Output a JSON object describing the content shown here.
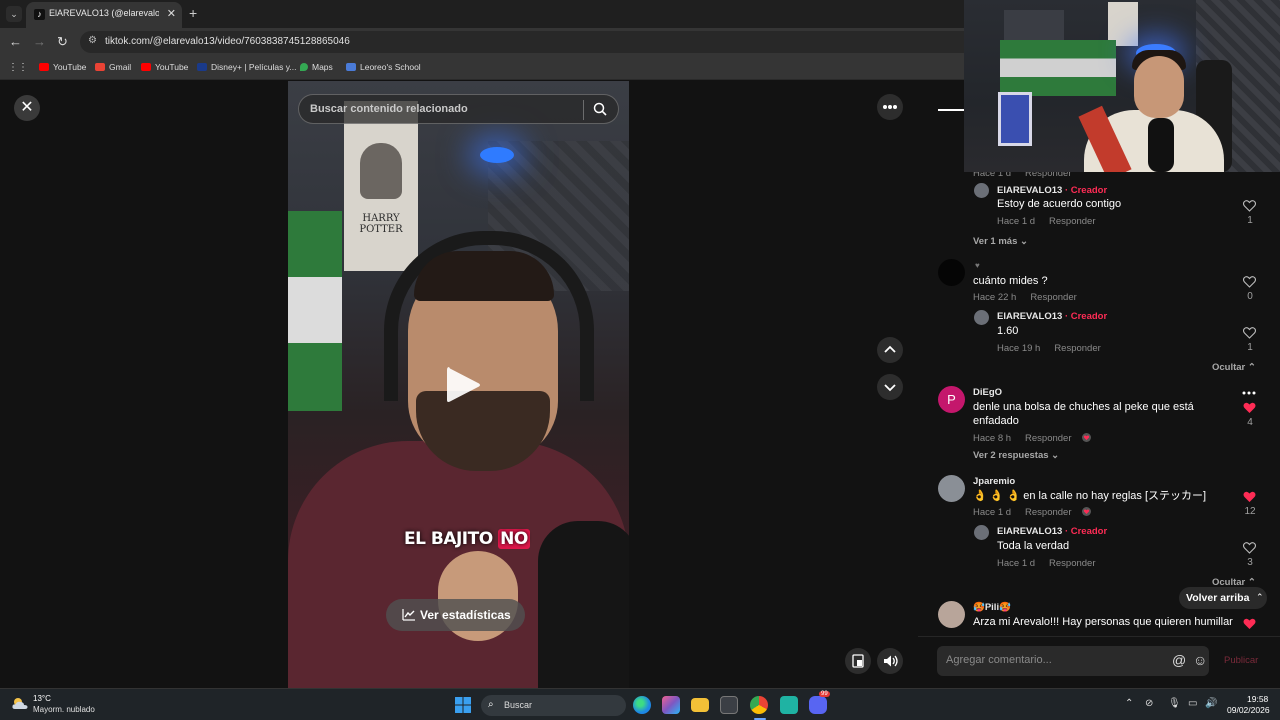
{
  "browser": {
    "tab_title": "ElAREVALO13 (@elarevalo13) |",
    "tab_close": "✕",
    "new_tab": "+",
    "tab_dropdown": "⌄",
    "back": "←",
    "forward": "→",
    "reload": "↻",
    "url": "tiktok.com/@elarevalo13/video/7603838745128865046",
    "bookmarks": [
      {
        "label": "YouTube",
        "icon": "youtube-icon",
        "color": "#ff0000"
      },
      {
        "label": "Gmail",
        "icon": "gmail-icon",
        "color": "#ea4335"
      },
      {
        "label": "YouTube",
        "icon": "youtube-icon",
        "color": "#ff0000"
      },
      {
        "label": "Disney+ | Películas y...",
        "icon": "disney-icon",
        "color": "#1a3a8a"
      },
      {
        "label": "Maps",
        "icon": "maps-icon",
        "color": "#34a853"
      },
      {
        "label": "Leoreo's School",
        "icon": "school-icon",
        "color": "#4a7bd8"
      }
    ]
  },
  "video": {
    "search_placeholder": "Buscar contenido relacionado",
    "poster_title": "HARRY POTTER",
    "caption_prefix": "EL BAJITO ",
    "caption_highlight": "NO",
    "stats_label": "Ver estadísticas",
    "close_label": "✕"
  },
  "comments": [
    {
      "id": "reply-1",
      "name": "ElAREVALO13",
      "creator": "· Creador",
      "text": "Estoy de acuerdo contigo",
      "time": "Hace 1 d",
      "reply": "Responder",
      "likes": "1"
    },
    {
      "id": "more-1",
      "link": "Ver 1 más"
    },
    {
      "id": "c-cuanto",
      "text": "cuánto mides ?",
      "time": "Hace 22 h",
      "reply": "Responder",
      "likes": "0"
    },
    {
      "id": "reply-2",
      "name": "ElAREVALO13",
      "creator": "· Creador",
      "text": "1.60",
      "time": "Hace 19 h",
      "reply": "Responder",
      "likes": "1"
    },
    {
      "id": "c-diego",
      "avatar_letter": "P",
      "name": "DiEgO",
      "text_line1": "denle una bolsa de chuches al peke que está",
      "text_line2": "enfadado",
      "time": "Hace 8 h",
      "reply": "Responder",
      "likes": "4",
      "more_replies": "Ver 2 respuestas"
    },
    {
      "id": "c-jparemio",
      "name": "Jparemio",
      "text": "👌 👌 👌 en la calle no hay reglas [ステッカー]",
      "time": "Hace 1 d",
      "reply": "Responder",
      "likes": "12"
    },
    {
      "id": "reply-3",
      "name": "ElAREVALO13",
      "creator": "· Creador",
      "text": "Toda la verdad",
      "time": "Hace 1 d",
      "reply": "Responder",
      "likes": "3"
    },
    {
      "id": "c-pili",
      "name": "🥵Pili🥵",
      "text": "Arza mi Arevalo!!! Hay personas que quieren humillar"
    }
  ],
  "partial_top": {
    "time": "Hace 1 d",
    "reply": "Responder"
  },
  "hide_label": "Ocultar",
  "back_to_top": "Volver arriba",
  "comment_placeholder": "Agregar comentario...",
  "at_symbol": "@",
  "emoji_symbol": "☺",
  "publish_label": "Publicar",
  "colors": {
    "accent": "#fe2c55",
    "bg": "#121212"
  },
  "taskbar": {
    "temp": "13°C",
    "weather": "Mayorm. nublado",
    "search_label": "Buscar",
    "time": "19:58",
    "date": "09/02/2026",
    "notification_badge": "99"
  }
}
